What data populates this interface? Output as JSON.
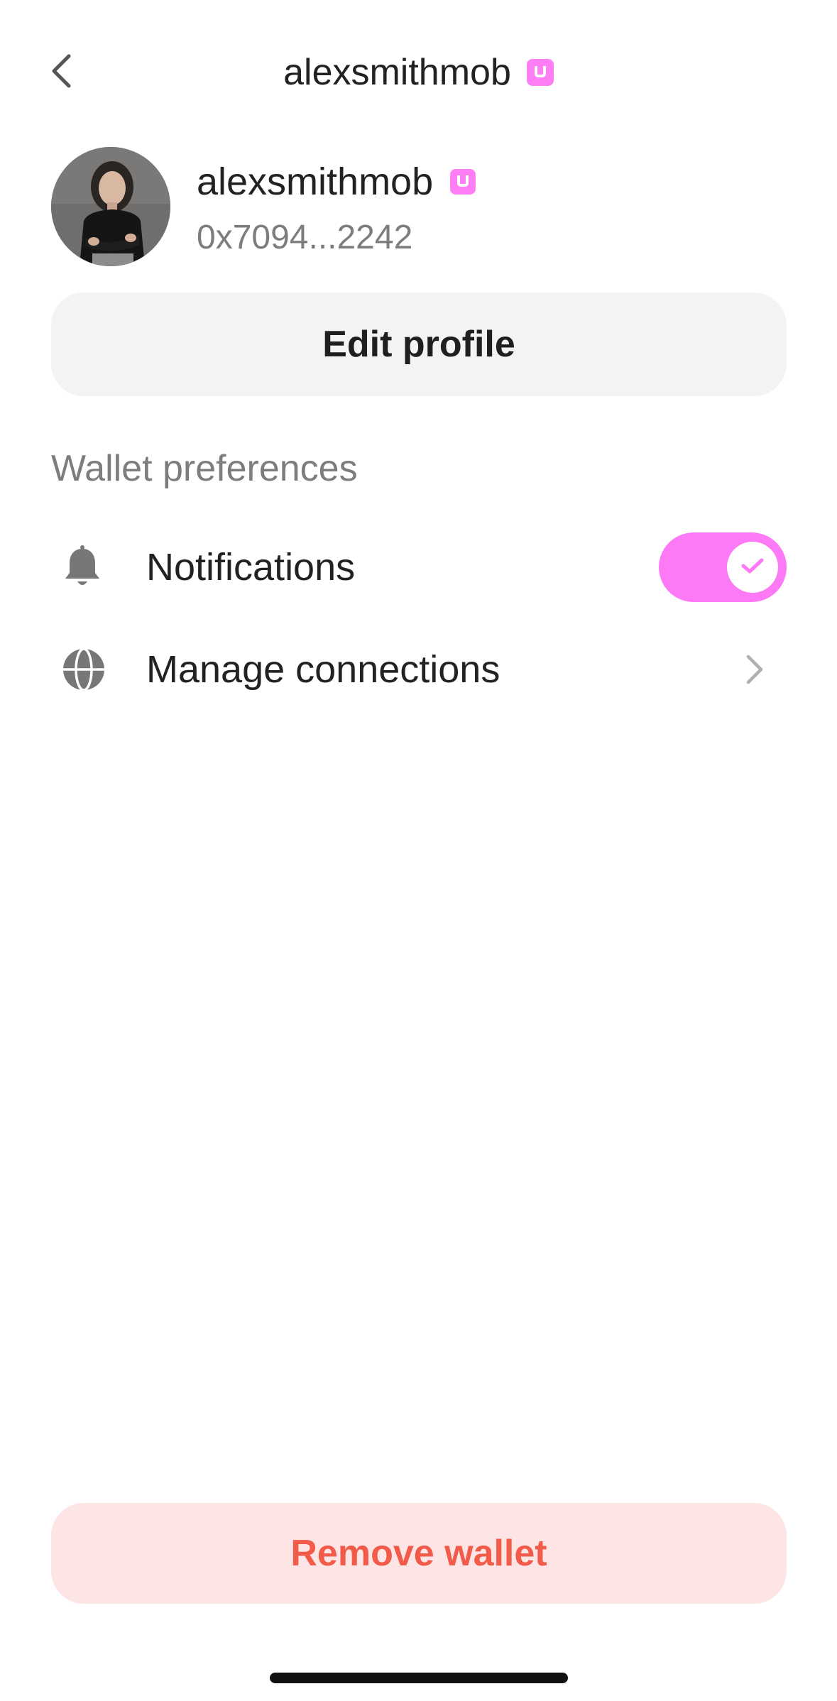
{
  "header": {
    "title": "alexsmithmob",
    "back_icon": "chevron-left-icon",
    "badge_icon": "uniswap-username-badge-icon"
  },
  "profile": {
    "username": "alexsmithmob",
    "address": "0x7094...2242",
    "avatar": "avatar-photo"
  },
  "actions": {
    "edit_profile_label": "Edit profile",
    "remove_wallet_label": "Remove wallet"
  },
  "preferences": {
    "section_title": "Wallet preferences",
    "items": [
      {
        "label": "Notifications",
        "icon": "bell-icon",
        "control": "toggle",
        "enabled": true
      },
      {
        "label": "Manage connections",
        "icon": "globe-icon",
        "control": "chevron-right-icon"
      }
    ]
  },
  "colors": {
    "accent": "#FE79F6",
    "danger_text": "#F25A4A",
    "danger_bg": "#FDE5E5",
    "secondary_text": "#7D7D7D",
    "button_bg": "#F3F3F3"
  }
}
